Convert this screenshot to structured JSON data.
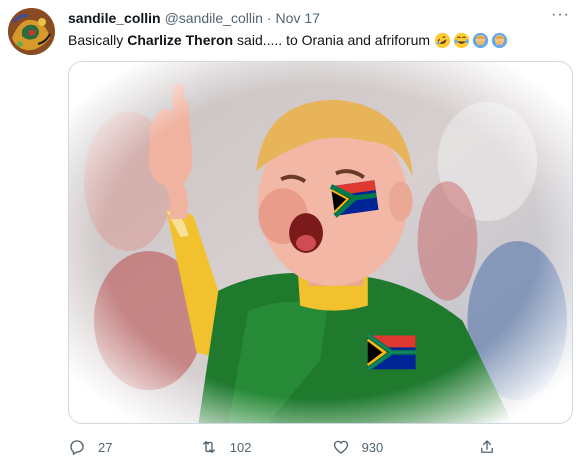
{
  "tweet": {
    "display_name": "sandile_collin",
    "handle": "@sandile_collin",
    "separator": "·",
    "date": "Nov 17",
    "more_label": "···",
    "text_before": "Basically",
    "text_bold": "Charlize Theron",
    "text_after": "said..... to Orania and afriforum",
    "emojis": [
      "rolling-on-floor-laughing",
      "face-with-tears-of-joy",
      "person-facepalming",
      "person-facepalming"
    ]
  },
  "actions": {
    "reply_count": "27",
    "retweet_count": "102",
    "like_count": "930"
  },
  "colors": {
    "text": "#0f1419",
    "secondary": "#536471",
    "border": "#cfd9de",
    "shirt_green": "#1f7a2e",
    "sleeve_yellow": "#f2c12e"
  },
  "icons": {
    "reply": "reply-icon",
    "retweet": "retweet-icon",
    "like": "heart-icon",
    "share": "share-icon",
    "more": "more-icon"
  }
}
